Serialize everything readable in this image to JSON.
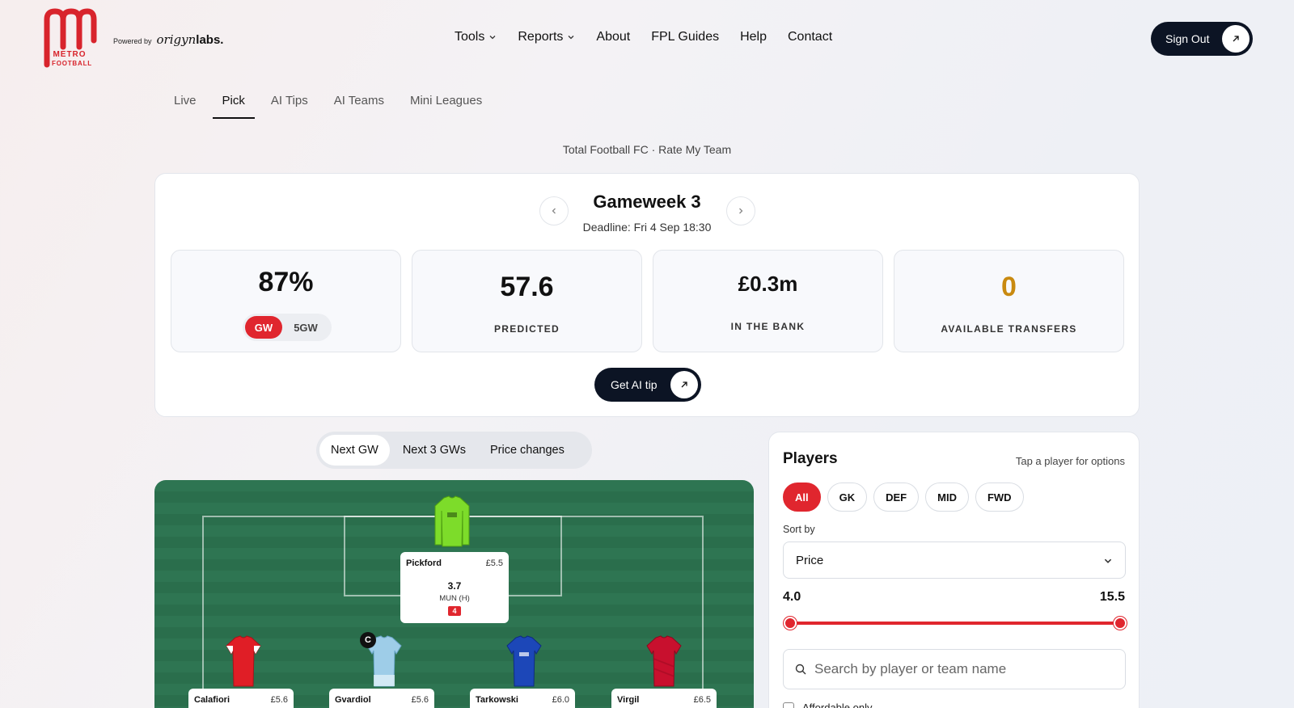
{
  "brand": {
    "logo_text": "METRO FOOTBALL",
    "powered_by": "Powered by",
    "partner_prefix": "origyn",
    "partner_suffix": "labs."
  },
  "nav": [
    {
      "label": "Tools",
      "dropdown": true
    },
    {
      "label": "Reports",
      "dropdown": true
    },
    {
      "label": "About",
      "dropdown": false
    },
    {
      "label": "FPL Guides",
      "dropdown": false
    },
    {
      "label": "Help",
      "dropdown": false
    },
    {
      "label": "Contact",
      "dropdown": false
    }
  ],
  "sign_out_label": "Sign Out",
  "tabs": [
    {
      "label": "Live",
      "active": false
    },
    {
      "label": "Pick",
      "active": true
    },
    {
      "label": "AI Tips",
      "active": false
    },
    {
      "label": "AI Teams",
      "active": false
    },
    {
      "label": "Mini Leagues",
      "active": false
    }
  ],
  "subtitle": "Total Football FC · Rate My Team",
  "gameweek": {
    "title": "Gameweek 3",
    "deadline": "Deadline: Fri 4 Sep 18:30"
  },
  "stats": {
    "rating": {
      "value": "87%",
      "toggle": [
        "GW",
        "5GW"
      ],
      "selected": "GW"
    },
    "predicted": {
      "value": "57.6",
      "label": "PREDICTED"
    },
    "bank": {
      "value": "£0.3m",
      "label": "IN THE BANK"
    },
    "transfers": {
      "value": "0",
      "label": "AVAILABLE TRANSFERS",
      "color": "#c98a10"
    }
  },
  "ai_tip_label": "Get AI tip",
  "view_toggle": {
    "options": [
      "Next GW",
      "Next 3 GWs",
      "Price changes"
    ],
    "selected": "Next GW"
  },
  "pitch": {
    "goalkeeper": {
      "name": "Pickford",
      "price": "£5.5",
      "points": "3.7",
      "fixture": "MUN (H)",
      "difficulty": "4"
    },
    "defenders": [
      {
        "name": "Calafiori",
        "price": "£5.6",
        "captain": false
      },
      {
        "name": "Gvardiol",
        "price": "£5.6",
        "captain": true,
        "captain_mark": "C"
      },
      {
        "name": "Tarkowski",
        "price": "£6.0",
        "captain": false
      },
      {
        "name": "Virgil",
        "price": "£6.5",
        "captain": false
      }
    ]
  },
  "players_panel": {
    "title": "Players",
    "hint": "Tap a player for options",
    "positions": [
      "All",
      "GK",
      "DEF",
      "MID",
      "FWD"
    ],
    "selected_position": "All",
    "sort_label": "Sort by",
    "sort_value": "Price",
    "price_min": "4.0",
    "price_max": "15.5",
    "search_placeholder": "Search by player or team name",
    "affordable_label": "Affordable only"
  },
  "colors": {
    "accent": "#e0262e",
    "dark": "#0c1424",
    "pitch": "#2e7552"
  }
}
